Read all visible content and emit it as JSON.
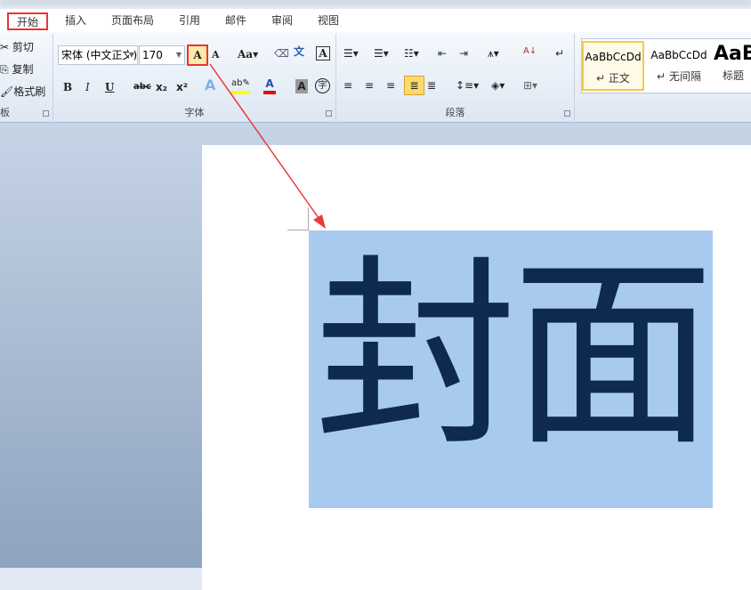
{
  "tabs": [
    {
      "label": "开始",
      "active": true
    },
    {
      "label": "插入"
    },
    {
      "label": "页面布局"
    },
    {
      "label": "引用"
    },
    {
      "label": "邮件"
    },
    {
      "label": "审阅"
    },
    {
      "label": "视图"
    }
  ],
  "clipboard": {
    "cut": "剪切",
    "copy": "复制",
    "format_painter": "格式刷",
    "label": "板"
  },
  "font": {
    "name": "宋体 (中文正文)",
    "size": "170",
    "grow_label": "A",
    "shrink_label": "A",
    "case_label": "Aa",
    "bold": "B",
    "italic": "I",
    "underline": "U",
    "strike": "abc",
    "subscript": "x₂",
    "superscript": "x²",
    "label": "字体",
    "highlight_color": "#ffff00",
    "font_color": "#e00000"
  },
  "paragraph": {
    "label": "段落"
  },
  "styles": {
    "items": [
      {
        "preview": "AaBbCcDd",
        "name": "正文",
        "selected": true
      },
      {
        "preview": "AaBbCcDd",
        "name": "无间隔"
      },
      {
        "preview": "AaB",
        "name": "标题"
      }
    ]
  },
  "document": {
    "text": "封面",
    "selection_color": "#a8caef",
    "text_color": "#0e2a4f"
  },
  "annotation": {
    "color": "#e83a3a"
  }
}
